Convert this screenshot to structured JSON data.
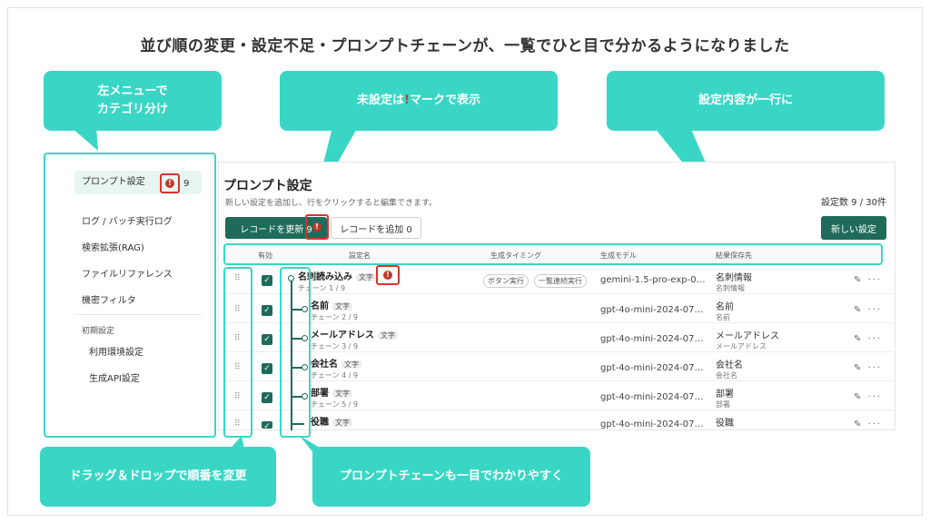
{
  "headline": "並び順の変更・設定不足・プロンプトチェーンが、一覧でひと目で分かるようになりました",
  "callouts": {
    "left_menu_line1": "左メニューで",
    "left_menu_line2": "カテゴリ分け",
    "unset_prefix": "未設定は",
    "unset_mark": "!",
    "unset_suffix": "マークで表示",
    "one_line": "設定内容が一行に",
    "drag_drop": "ドラッグ＆ドロップで順番を変更",
    "chain": "プロンプトチェーンも一目でわかりやすく"
  },
  "sidebar": {
    "active_item": "プロンプト設定",
    "active_count": "9",
    "warn_icon": "!",
    "items": [
      "ログ / バッチ実行ログ",
      "検索拡張(RAG)",
      "ファイルリファレンス",
      "機密フィルタ"
    ],
    "section_label": "初期設定",
    "sub_items": [
      "利用環境設定",
      "生成API設定"
    ]
  },
  "main": {
    "title": "プロンプト設定",
    "subtitle": "新しい設定を追加し、行をクリックすると編集できます。",
    "setting_count": "設定数 9 / 30件",
    "btn_update": "レコードを更新 9",
    "btn_add": "レコードを追加 0",
    "btn_new": "新しい設定",
    "warn_icon": "!"
  },
  "table": {
    "headers": {
      "enabled": "有効",
      "name": "設定名",
      "timing": "生成タイミング",
      "model": "生成モデル",
      "dest": "結果保存先"
    },
    "rows": [
      {
        "name": "名刺読み込み",
        "tag": "文字",
        "chain": "チェーン 1 / 9",
        "model": "gemini-1.5-pro-exp-0…",
        "dest": "名刺情報",
        "dest_sub": "名刺情報",
        "timing1": "ボタン実行",
        "timing2": "一覧連続実行"
      },
      {
        "name": "名前",
        "tag": "文字",
        "chain": "チェーン 2 / 9",
        "model": "gpt-4o-mini-2024-07…",
        "dest": "名前",
        "dest_sub": "名前"
      },
      {
        "name": "メールアドレス",
        "tag": "文字",
        "chain": "チェーン 3 / 9",
        "model": "gpt-4o-mini-2024-07…",
        "dest": "メールアドレス",
        "dest_sub": "メールアドレス"
      },
      {
        "name": "会社名",
        "tag": "文字",
        "chain": "チェーン 4 / 9",
        "model": "gpt-4o-mini-2024-07…",
        "dest": "会社名",
        "dest_sub": "会社名"
      },
      {
        "name": "部署",
        "tag": "文字",
        "chain": "チェーン 5 / 9",
        "model": "gpt-4o-mini-2024-07…",
        "dest": "部署",
        "dest_sub": "部署"
      },
      {
        "name": "役職",
        "tag": "文字",
        "chain": "",
        "model": "gpt-4o-mini-2024-07…",
        "dest": "役職",
        "dest_sub": ""
      }
    ],
    "drag_handle": "⠿",
    "check_mark": "✓",
    "edit_icon": "✎",
    "more_icon": "···"
  },
  "colors": {
    "accent": "#3ad6c5",
    "primary": "#1f6b5a",
    "warning": "#d9342b"
  }
}
